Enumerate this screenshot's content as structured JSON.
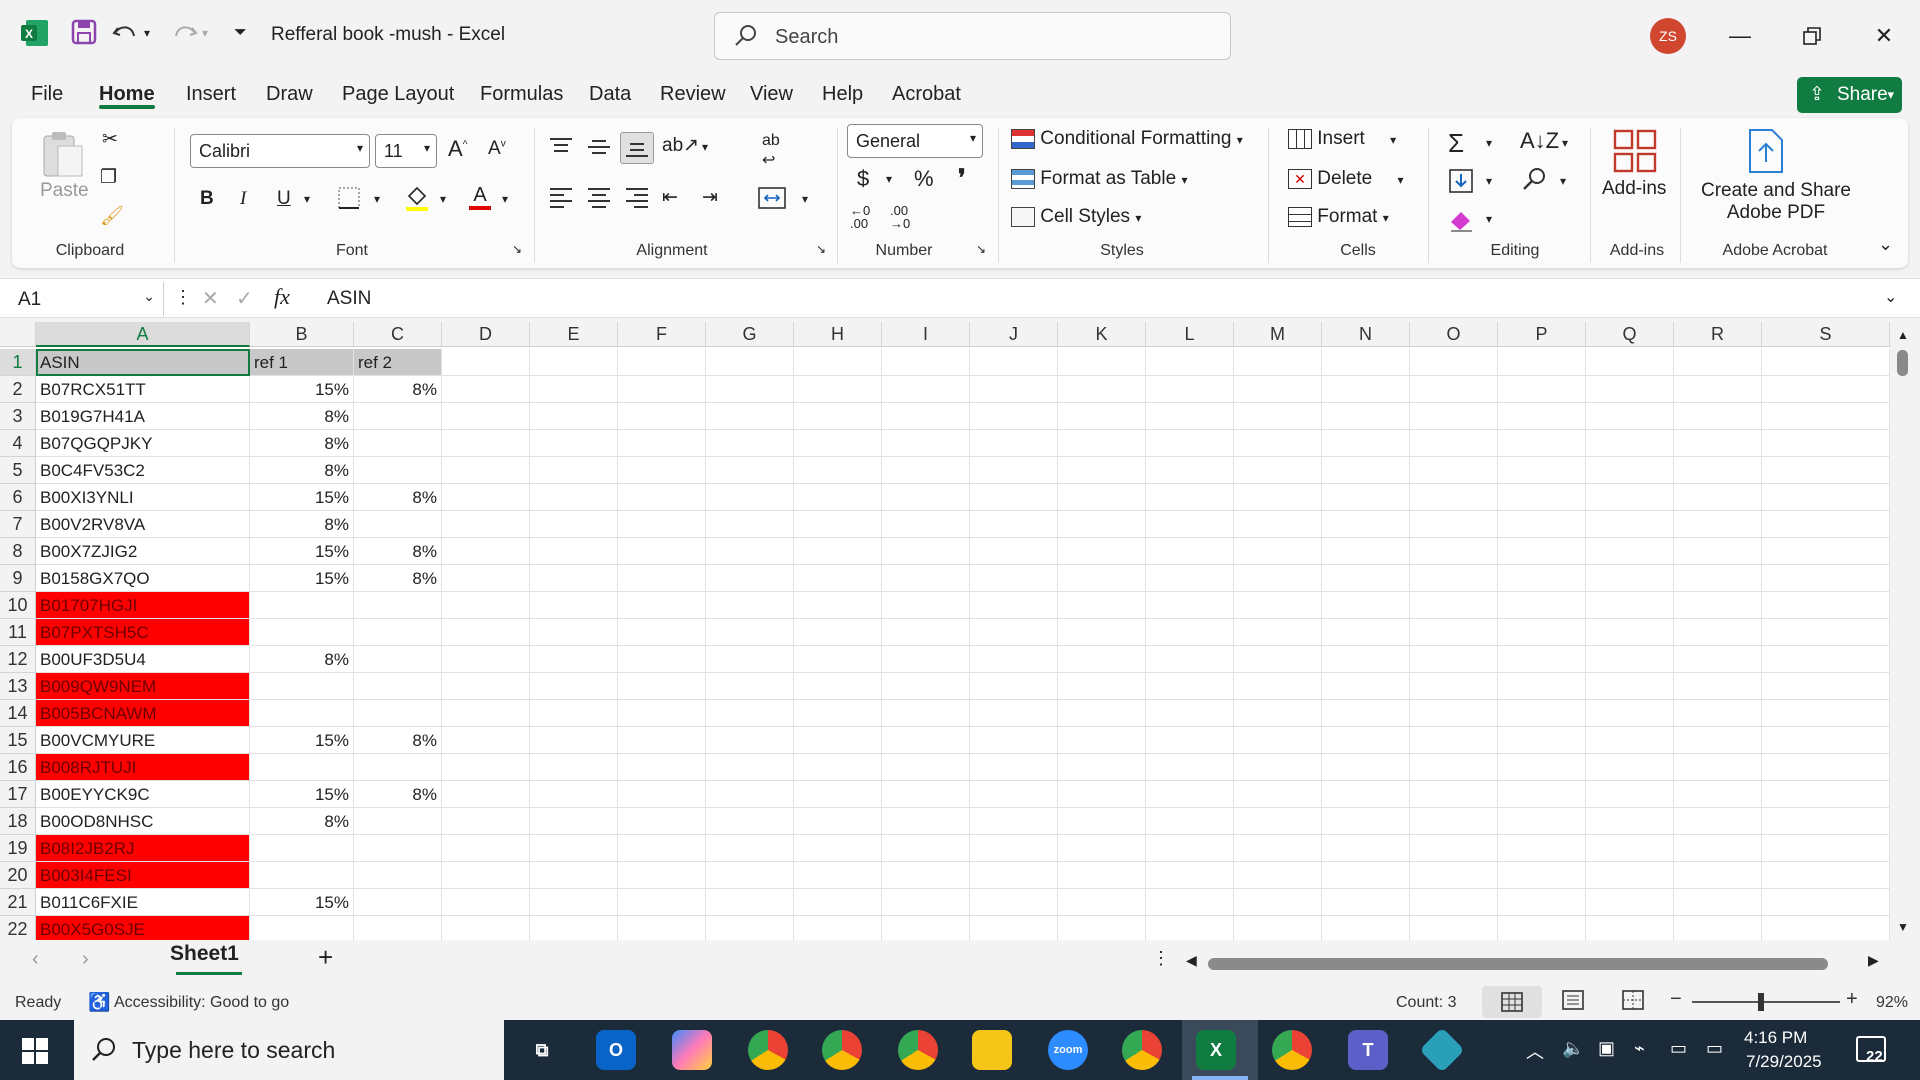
{
  "window": {
    "title": "Refferal book -mush  -  Excel",
    "search_placeholder": "Search",
    "avatar_initials": "ZS",
    "accent_color": "#107c41"
  },
  "menu": {
    "tabs": [
      "File",
      "Home",
      "Insert",
      "Draw",
      "Page Layout",
      "Formulas",
      "Data",
      "Review",
      "View",
      "Help",
      "Acrobat"
    ],
    "active": "Home",
    "share_label": "Share"
  },
  "ribbon": {
    "clipboard": {
      "paste_label": "Paste",
      "group_label": "Clipboard"
    },
    "font": {
      "font_name": "Calibri",
      "font_size": "11",
      "group_label": "Font"
    },
    "alignment": {
      "group_label": "Alignment"
    },
    "number": {
      "format": "General",
      "group_label": "Number"
    },
    "styles": {
      "conditional_formatting": "Conditional Formatting",
      "format_as_table": "Format as Table",
      "cell_styles": "Cell Styles",
      "group_label": "Styles"
    },
    "cells": {
      "insert": "Insert",
      "delete": "Delete",
      "format": "Format",
      "group_label": "Cells"
    },
    "editing": {
      "group_label": "Editing"
    },
    "addins": {
      "label": "Add-ins",
      "group_label": "Add-ins"
    },
    "acrobat": {
      "label_line1": "Create and Share",
      "label_line2": "Adobe PDF",
      "group_label": "Adobe Acrobat"
    }
  },
  "formula_bar": {
    "name_box": "A1",
    "fx": "fx",
    "value": "ASIN"
  },
  "grid": {
    "columns": [
      "A",
      "B",
      "C",
      "D",
      "E",
      "F",
      "G",
      "H",
      "I",
      "J",
      "K",
      "L",
      "M",
      "N",
      "O",
      "P",
      "Q",
      "R",
      "S"
    ],
    "header_fill": "#c8c8c8",
    "highlight_color": "#ff0000",
    "rows": [
      {
        "n": "1",
        "a": "ASIN",
        "b": "ref 1",
        "c": "ref 2",
        "red": false,
        "header": true
      },
      {
        "n": "2",
        "a": "B07RCX51TT",
        "b": "15%",
        "c": "8%",
        "red": false
      },
      {
        "n": "3",
        "a": "B019G7H41A",
        "b": "8%",
        "c": "",
        "red": false
      },
      {
        "n": "4",
        "a": "B07QGQPJKY",
        "b": "8%",
        "c": "",
        "red": false
      },
      {
        "n": "5",
        "a": "B0C4FV53C2",
        "b": "8%",
        "c": "",
        "red": false
      },
      {
        "n": "6",
        "a": "B00XI3YNLI",
        "b": "15%",
        "c": "8%",
        "red": false
      },
      {
        "n": "7",
        "a": "B00V2RV8VA",
        "b": "8%",
        "c": "",
        "red": false
      },
      {
        "n": "8",
        "a": "B00X7ZJIG2",
        "b": "15%",
        "c": "8%",
        "red": false
      },
      {
        "n": "9",
        "a": "B0158GX7QO",
        "b": "15%",
        "c": "8%",
        "red": false
      },
      {
        "n": "10",
        "a": "B01707HGJI",
        "b": "",
        "c": "",
        "red": true
      },
      {
        "n": "11",
        "a": "B07PXTSH5C",
        "b": "",
        "c": "",
        "red": true
      },
      {
        "n": "12",
        "a": "B00UF3D5U4",
        "b": "8%",
        "c": "",
        "red": false
      },
      {
        "n": "13",
        "a": "B009QW9NEM",
        "b": "",
        "c": "",
        "red": true
      },
      {
        "n": "14",
        "a": "B005BCNAWM",
        "b": "",
        "c": "",
        "red": true
      },
      {
        "n": "15",
        "a": "B00VCMYURE",
        "b": "15%",
        "c": "8%",
        "red": false
      },
      {
        "n": "16",
        "a": "B008RJTUJI",
        "b": "",
        "c": "",
        "red": true
      },
      {
        "n": "17",
        "a": "B00EYYCK9C",
        "b": "15%",
        "c": "8%",
        "red": false
      },
      {
        "n": "18",
        "a": "B00OD8NHSC",
        "b": "8%",
        "c": "",
        "red": false
      },
      {
        "n": "19",
        "a": "B08I2JB2RJ",
        "b": "",
        "c": "",
        "red": true
      },
      {
        "n": "20",
        "a": "B003I4FESI",
        "b": "",
        "c": "",
        "red": true
      },
      {
        "n": "21",
        "a": "B011C6FXIE",
        "b": "15%",
        "c": "",
        "red": false
      },
      {
        "n": "22",
        "a": "B00X5G0SJE",
        "b": "",
        "c": "",
        "red": true
      }
    ]
  },
  "sheets": {
    "tabs": [
      "Sheet1"
    ],
    "active": "Sheet1"
  },
  "status": {
    "ready": "Ready",
    "accessibility": "Accessibility: Good to go",
    "count": "Count: 3",
    "zoom": "92%"
  },
  "taskbar": {
    "search_placeholder": "Type here to search",
    "time": "4:16 PM",
    "date": "7/29/2025",
    "notification_count": "22",
    "apps": [
      "task-view",
      "outlook",
      "copilot",
      "chrome-profile-1",
      "chrome-profile-2",
      "chrome-profile-3",
      "file-explorer",
      "zoom",
      "chrome",
      "excel",
      "chrome-profile-z",
      "teams",
      "app"
    ]
  }
}
